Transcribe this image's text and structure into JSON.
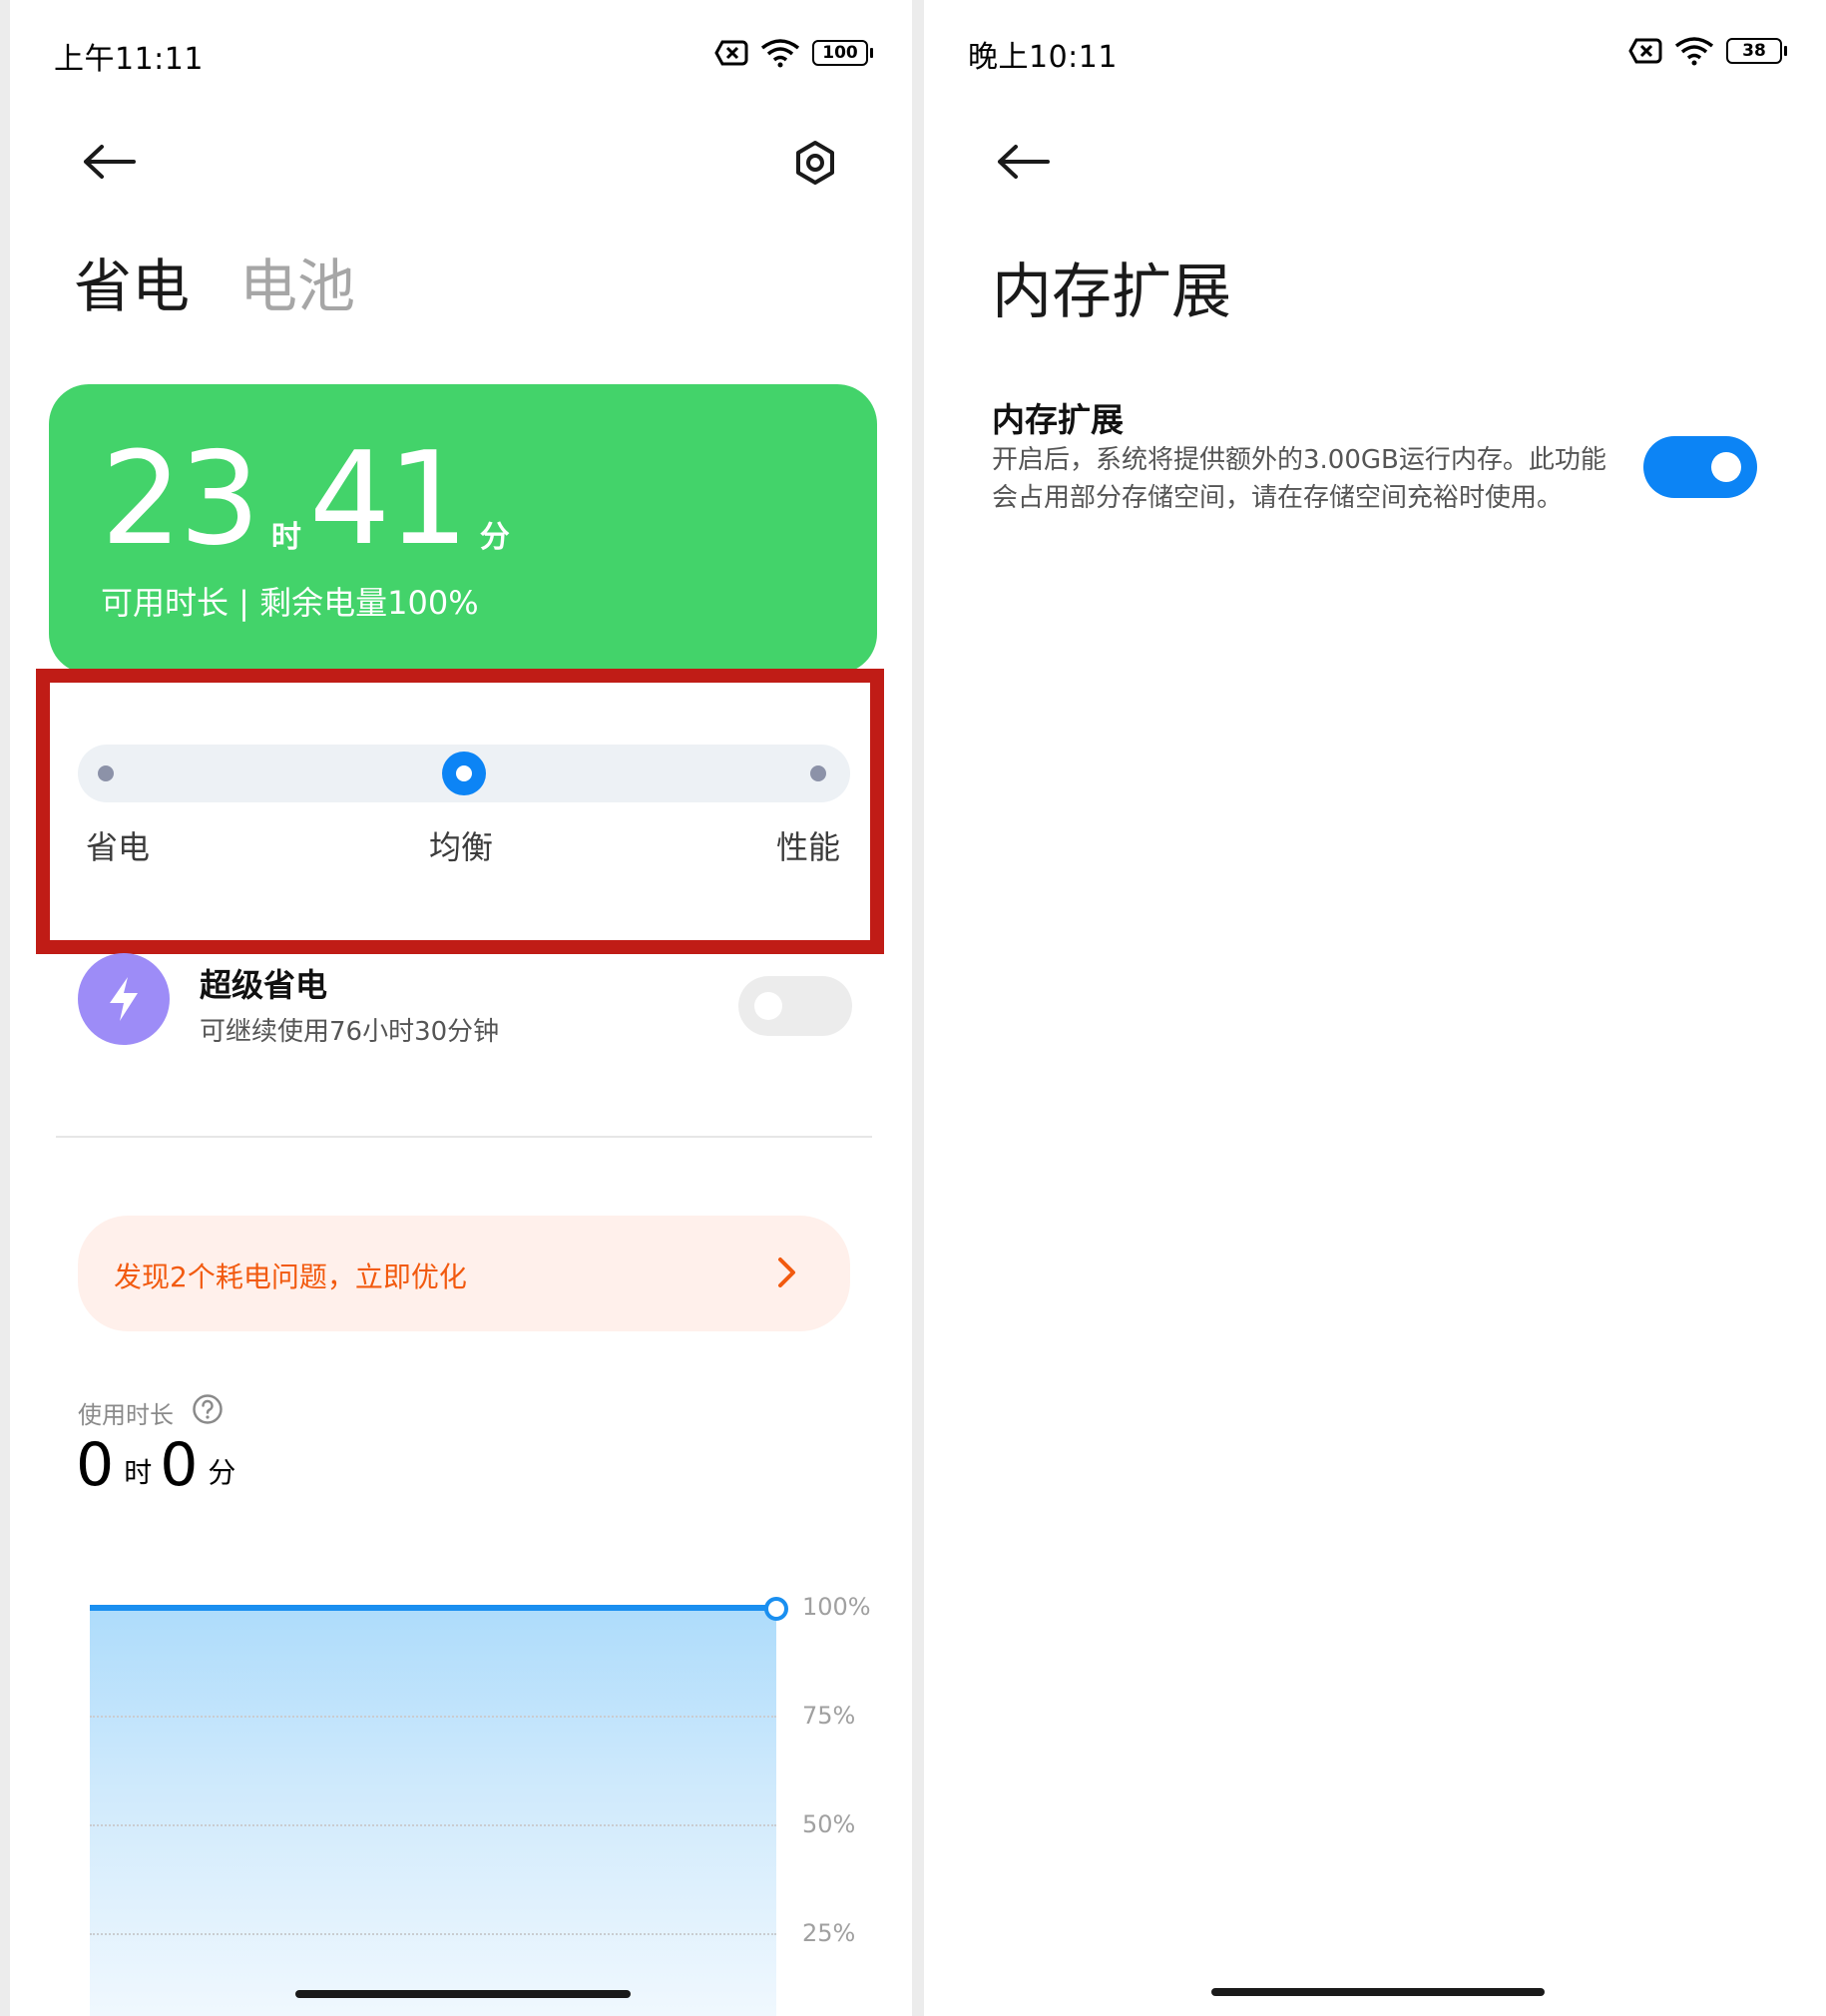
{
  "left": {
    "status_time": "上午11:11",
    "battery_level": "100",
    "tabs": [
      "省电",
      "电池"
    ],
    "card": {
      "hours": "23",
      "hours_unit": "时",
      "minutes": "41",
      "minutes_unit": "分",
      "subtitle": "可用时长 | 剩余电量100%"
    },
    "mode_selector": {
      "options": [
        "省电",
        "均衡",
        "性能"
      ],
      "selected": "均衡"
    },
    "super_saver": {
      "title": "超级省电",
      "subtitle": "可继续使用76小时30分钟",
      "enabled": false
    },
    "promo": {
      "text": "发现2个耗电问题，立即优化"
    },
    "usage": {
      "label": "使用时长",
      "hours": "0",
      "hours_unit": "时",
      "minutes": "0",
      "minutes_unit": "分"
    },
    "chart_data": {
      "type": "area",
      "y_ticks": [
        "100%",
        "75%",
        "50%",
        "25%"
      ],
      "ylim": [
        0,
        100
      ],
      "values": [
        100,
        100
      ],
      "colors": {
        "line": "#1a8ff0",
        "fill": "#aedcfb"
      }
    }
  },
  "right": {
    "status_time": "晚上10:11",
    "battery_level": "38",
    "page_title": "内存扩展",
    "setting": {
      "title": "内存扩展",
      "description": "开启后，系统将提供额外的3.00GB运行内存。此功能会占用部分存储空间，请在存储空间充裕时使用。",
      "enabled": true
    }
  },
  "colors": {
    "accent": "#0c84f5",
    "card_green": "#43d36a",
    "highlight_red": "#c01c16",
    "promo_orange": "#f25a0f",
    "bolt_purple": "#9d8cf7"
  },
  "icons": {
    "back": "arrow-left-icon",
    "settings": "gear-icon",
    "bolt": "lightning-icon",
    "help": "question-circle-icon",
    "chevron": "chevron-right-icon"
  }
}
